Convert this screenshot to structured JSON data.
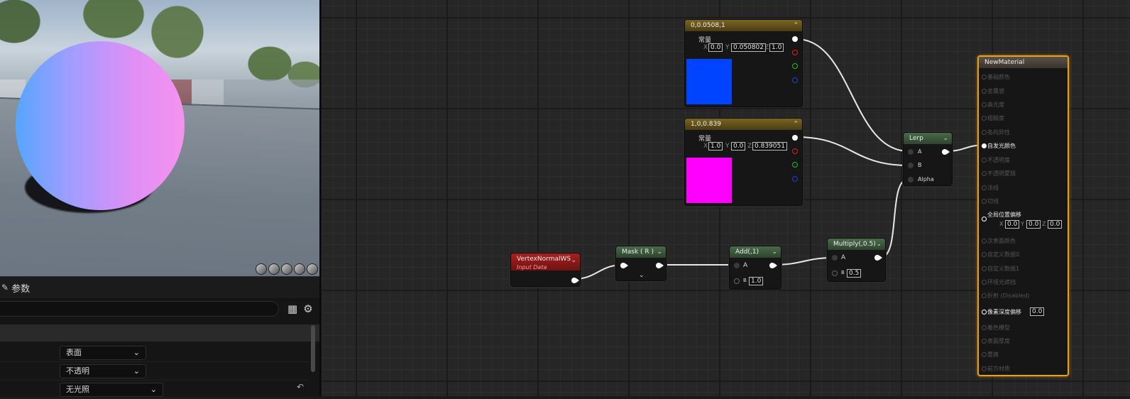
{
  "viewport": {
    "preview_colors": {
      "sphere_left": "#56a6ff",
      "sphere_right": "#f592f0"
    },
    "view_mode_icons": [
      "cylinder-icon",
      "sphere-icon",
      "plane-icon",
      "cube-icon",
      "teapot-icon"
    ]
  },
  "details": {
    "tab_label": "参数",
    "dropdowns": [
      "表面",
      "不透明",
      "无光照"
    ]
  },
  "nodes": {
    "const1": {
      "title": "0,0.0508,1",
      "label": "常量",
      "x": "0.0",
      "y": "0.050802",
      "z": "1.0",
      "color": "#0044ff"
    },
    "const2": {
      "title": "1,0,0.839",
      "label": "常量",
      "x": "1.0",
      "y": "0.0",
      "z": "0.839051",
      "color": "#ff00ff"
    },
    "vertex": {
      "title": "VertexNormalWS",
      "subtitle": "Input Data"
    },
    "mask": {
      "title": "Mask ( R )"
    },
    "add": {
      "title": "Add(,1)",
      "pin_a": "A",
      "pin_b": "B",
      "b_value": "1.0"
    },
    "multiply": {
      "title": "Multiply(,0.5)",
      "pin_a": "A",
      "pin_b": "B",
      "b_value": "0.5"
    },
    "lerp": {
      "title": "Lerp",
      "pin_a": "A",
      "pin_b": "B",
      "pin_alpha": "Alpha"
    },
    "material": {
      "title": "NewMaterial",
      "inputs": [
        "基础颜色",
        "金属感",
        "高光度",
        "粗糙度",
        "各向异性",
        "自发光颜色",
        "不透明度",
        "不透明蒙版",
        "法线",
        "切线",
        "全局位置偏移",
        "次表面颜色",
        "自定义数据0",
        "自定义数据1",
        "环境光遮挡",
        "折射 (Disabled)",
        "像素深度偏移",
        "着色模型",
        "表面厚度",
        "置换",
        "前方材质"
      ],
      "wpo_x": "0.0",
      "wpo_y": "0.0",
      "wpo_z": "0.0",
      "pixel_depth_value": "0.0"
    }
  }
}
